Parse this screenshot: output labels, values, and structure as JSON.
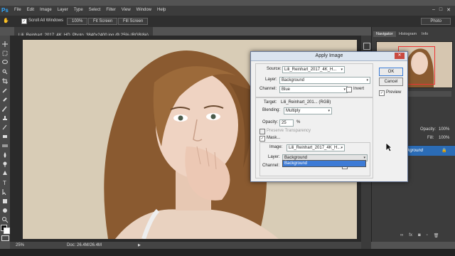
{
  "app": {
    "logo": "Ps"
  },
  "menu": [
    "File",
    "Edit",
    "Image",
    "Layer",
    "Type",
    "Select",
    "Filter",
    "View",
    "Window",
    "Help"
  ],
  "window_controls": [
    "–",
    "□",
    "✕"
  ],
  "options_bar": {
    "scroll_all_windows": "Scroll All Windows",
    "zoom_100": "100%",
    "fit_screen": "Fit Screen",
    "fill_screen": "Fill Screen",
    "workspace": "Photo"
  },
  "document": {
    "tab_title": "Lili_Reinhart_2017_4K_HD_Photo_3840x2400.jpg @ 25% (RGB/8#)",
    "zoom": "25%",
    "doc_size": "Doc: 26.4M/26.4M"
  },
  "panels": {
    "tabs": [
      "Navigator",
      "Histogram",
      "Info"
    ],
    "opacity_label": "Opacity:",
    "opacity_value": "100%",
    "fill_label": "Fill:",
    "fill_value": "100%",
    "layer_name": "Background"
  },
  "dialog": {
    "title": "Apply Image",
    "source_label": "Source:",
    "source_value": "Lili_Reinhart_2017_4K_H...",
    "layer_label": "Layer:",
    "layer_value": "Background",
    "channel_label": "Channel:",
    "channel_value": "Blue",
    "invert_label": "Invert",
    "target_label": "Target:",
    "target_value": "Lili_Reinhart_201... (RGB)",
    "blending_label": "Blending:",
    "blending_value": "Multiply",
    "opacity_label": "Opacity:",
    "opacity_value": "25",
    "opacity_unit": "%",
    "preserve_label": "Preserve Transparency",
    "mask_label": "Mask...",
    "mask_image_label": "Image:",
    "mask_image_value": "Lili_Reinhart_2017_4K_H...",
    "mask_layer_label": "Layer:",
    "mask_layer_value": "Background",
    "mask_channel_label": "Channel:",
    "mask_invert_label": "Invert",
    "dropdown_option": "Background",
    "ok_label": "OK",
    "cancel_label": "Cancel",
    "preview_label": "Preview"
  }
}
